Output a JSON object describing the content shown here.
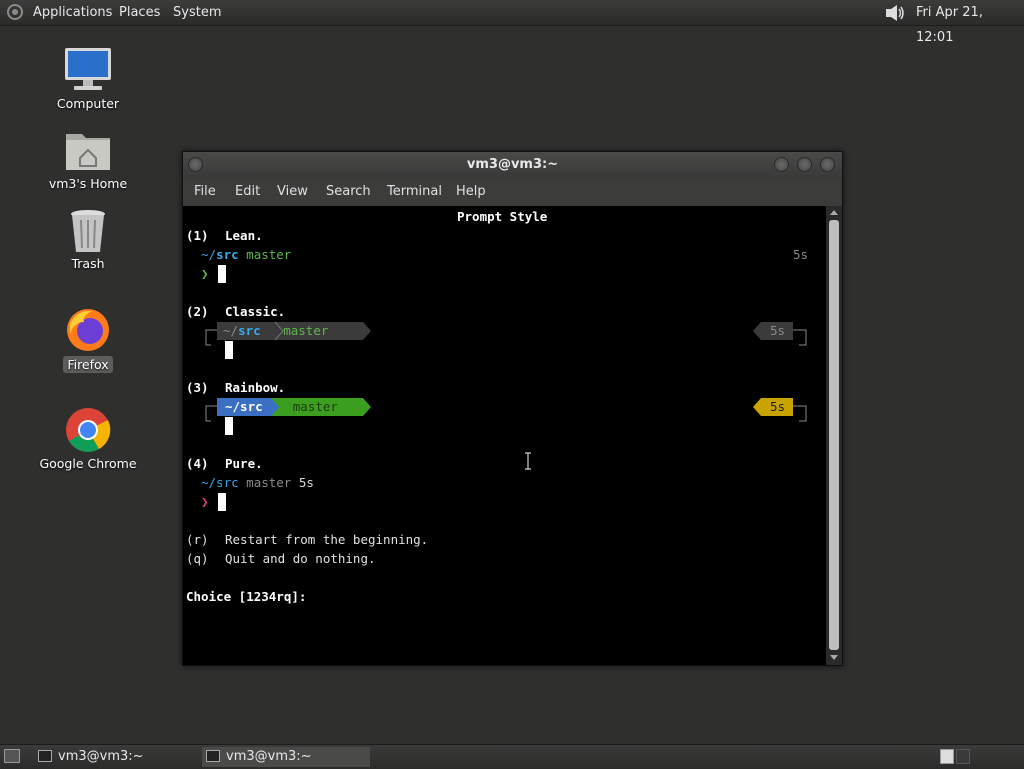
{
  "top_panel": {
    "menus": [
      "Applications",
      "Places",
      "System"
    ],
    "clock": "Fri Apr 21, 12:01"
  },
  "desktop": {
    "icons": [
      {
        "label": "Computer"
      },
      {
        "label": "vm3's Home"
      },
      {
        "label": "Trash"
      },
      {
        "label": "Firefox"
      },
      {
        "label": "Google Chrome"
      }
    ]
  },
  "window": {
    "title": "vm3@vm3:~",
    "menu": [
      "File",
      "Edit",
      "View",
      "Search",
      "Terminal",
      "Help"
    ]
  },
  "terminal": {
    "heading": "Prompt Style",
    "options": [
      {
        "num": "(1)",
        "name": "Lean."
      },
      {
        "num": "(2)",
        "name": "Classic."
      },
      {
        "num": "(3)",
        "name": "Rainbow."
      },
      {
        "num": "(4)",
        "name": "Pure."
      }
    ],
    "prompt": {
      "dir_prefix": "~/",
      "dir": "src",
      "dir_full": "~/src",
      "branch": "master",
      "time": "5s",
      "chevron": "❯"
    },
    "extra": [
      {
        "key": "(r)",
        "text": "Restart from the beginning."
      },
      {
        "key": "(q)",
        "text": "Quit and do nothing."
      }
    ],
    "choice": "Choice [1234rq]:"
  },
  "taskbar": {
    "items": [
      "vm3@vm3:~",
      "vm3@vm3:~"
    ]
  }
}
